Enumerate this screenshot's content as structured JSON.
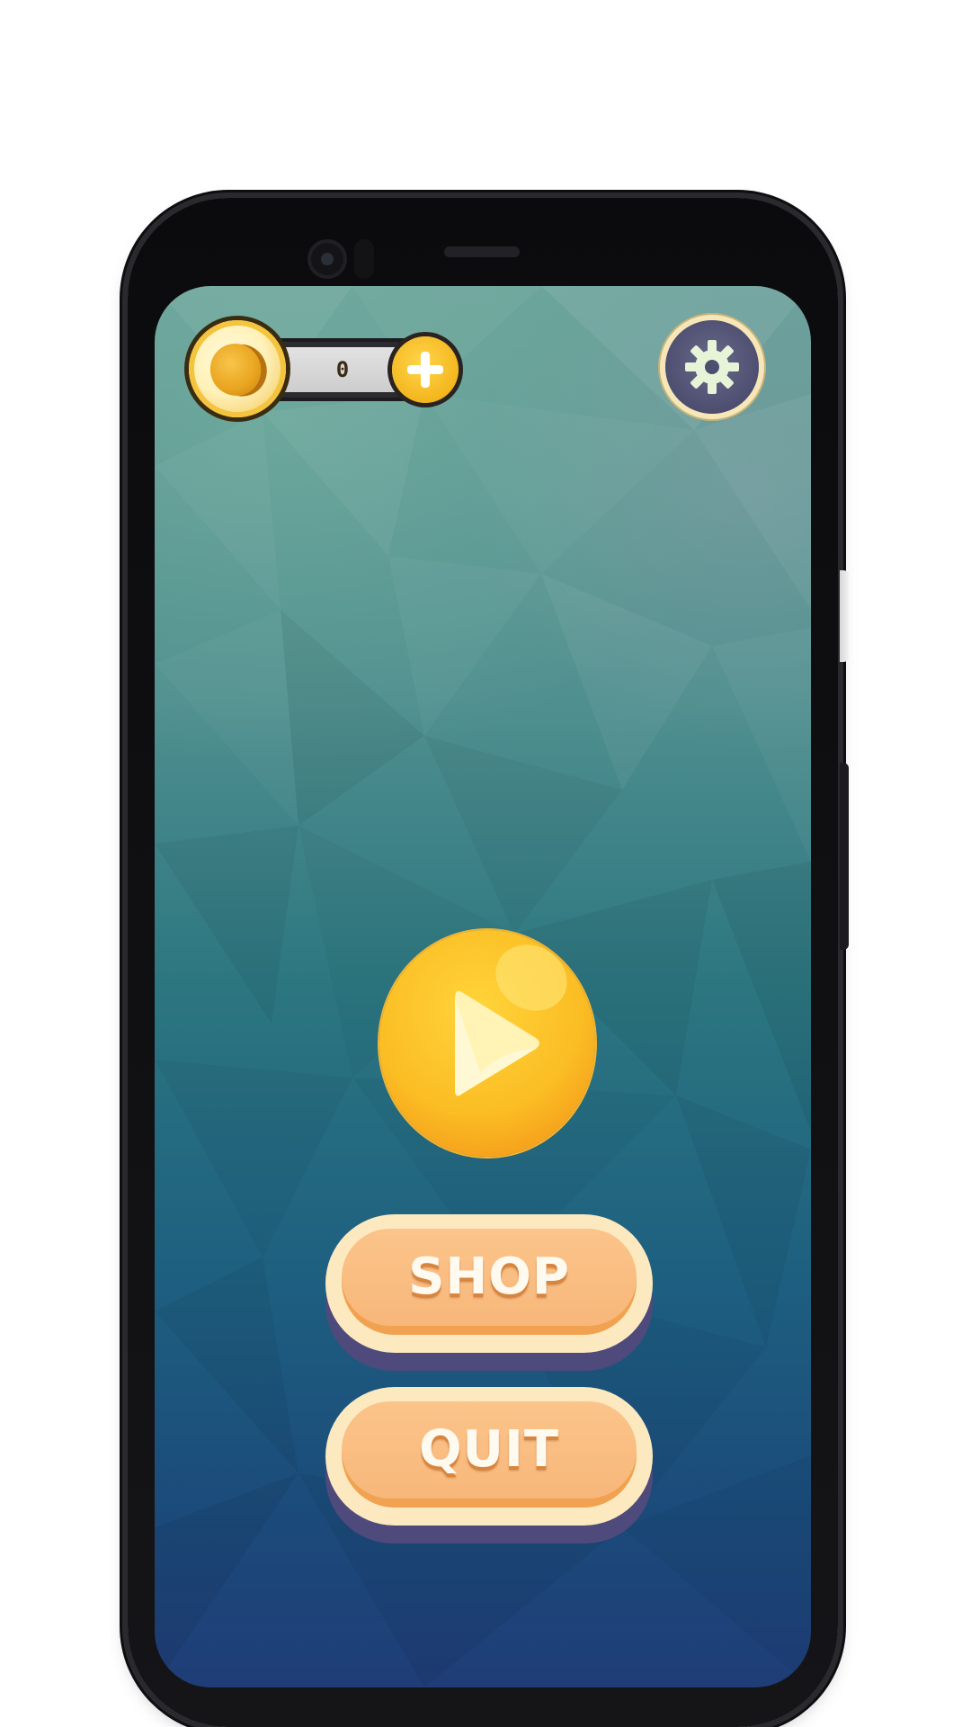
{
  "hud": {
    "coin_count": "0",
    "coin_icon": "coin-icon",
    "add_coins_icon": "plus-icon",
    "settings_icon": "gear-icon"
  },
  "play": {
    "icon": "play-icon"
  },
  "menu": {
    "shop_label": "SHOP",
    "quit_label": "QUIT"
  },
  "colors": {
    "background_top": "#69a19a",
    "background_bottom": "#1f3d78",
    "play_button": "#fbbd24",
    "menu_button": "#f8b77a",
    "menu_button_rim": "#fde9bf",
    "settings_button": "#4d4e70"
  }
}
